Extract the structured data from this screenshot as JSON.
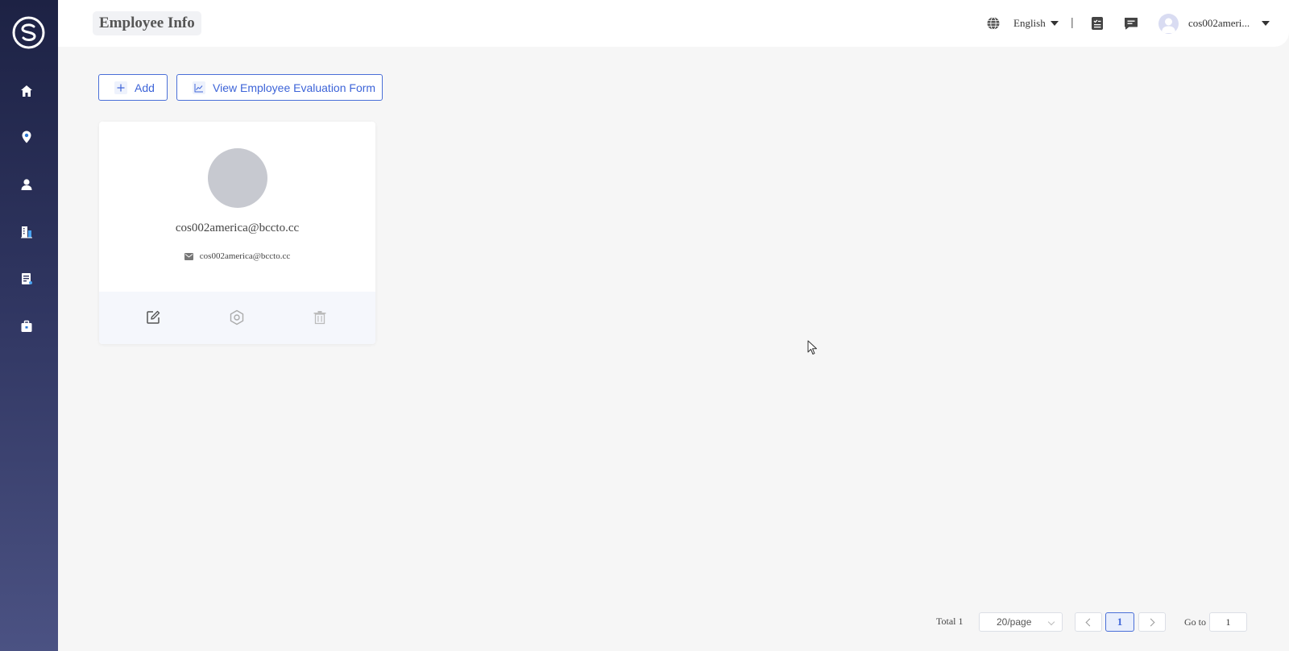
{
  "header": {
    "title": "Employee Info",
    "language": "English",
    "separator": "|",
    "user_name": "cos002ameri..."
  },
  "toolbar": {
    "add_label": "Add",
    "eval_label": "View Employee Evaluation Form"
  },
  "employees": [
    {
      "name": "cos002america@bccto.cc",
      "email": "cos002america@bccto.cc"
    }
  ],
  "sidebar": {
    "items": [
      {
        "icon": "home-icon"
      },
      {
        "icon": "location-pin-icon"
      },
      {
        "icon": "person-icon"
      },
      {
        "icon": "building-icon"
      },
      {
        "icon": "document-icon"
      },
      {
        "icon": "briefcase-icon"
      }
    ]
  },
  "pagination": {
    "total": "Total 1",
    "page_size": "20/page",
    "current_page": "1",
    "goto_label": "Go to",
    "goto_value": "1"
  },
  "colors": {
    "accent": "#3d64d8",
    "sidebar_top": "#1d2244",
    "sidebar_bottom": "#4b5283"
  }
}
